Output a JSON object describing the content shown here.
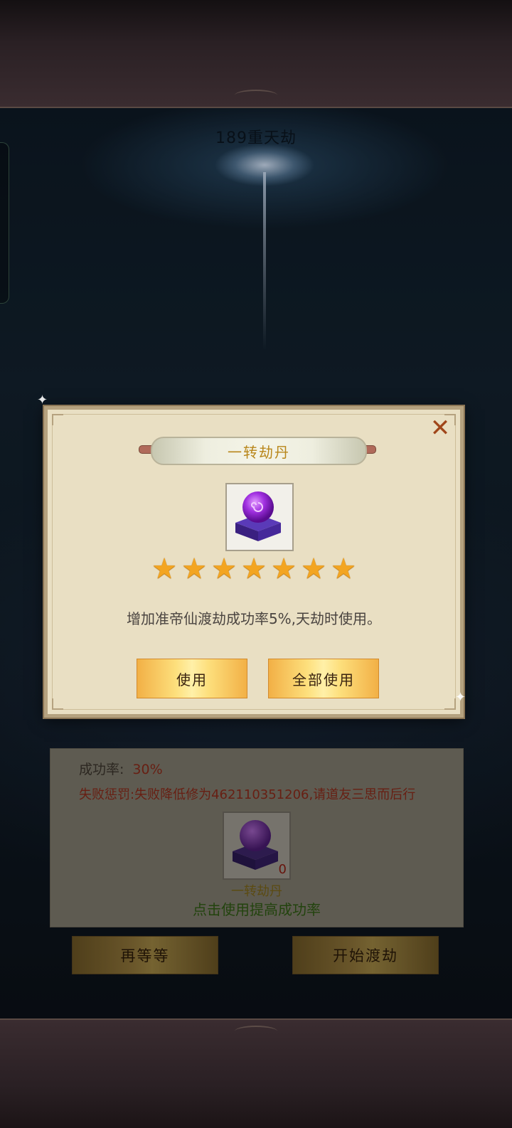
{
  "stage": {
    "title": "189重天劫"
  },
  "info": {
    "rate_label": "成功率:",
    "rate_value": "30%",
    "penalty": "失败惩罚:失败降低修为462110351206,请道友三思而后行",
    "item_count": "0",
    "item_name": "一转劫丹",
    "hint": "点击使用提高成功率"
  },
  "buttons": {
    "wait": "再等等",
    "start": "开始渡劫"
  },
  "modal": {
    "title": "一转劫丹",
    "star_count": 7,
    "stars": [
      "★",
      "★",
      "★",
      "★",
      "★",
      "★",
      "★"
    ],
    "description": "增加准帝仙渡劫成功率5%,天劫时使用。",
    "use_label": "使用",
    "use_all_label": "全部使用",
    "close_symbol": "✕"
  },
  "icons": {
    "close": "close-icon",
    "item": "purple-orb-pedestal-icon",
    "star": "star-icon"
  },
  "colors": {
    "title_gold": "#b8861a",
    "star_orange": "#f3a521",
    "penalty_red": "#8a2a1a",
    "hint_green": "#2e5a12"
  }
}
